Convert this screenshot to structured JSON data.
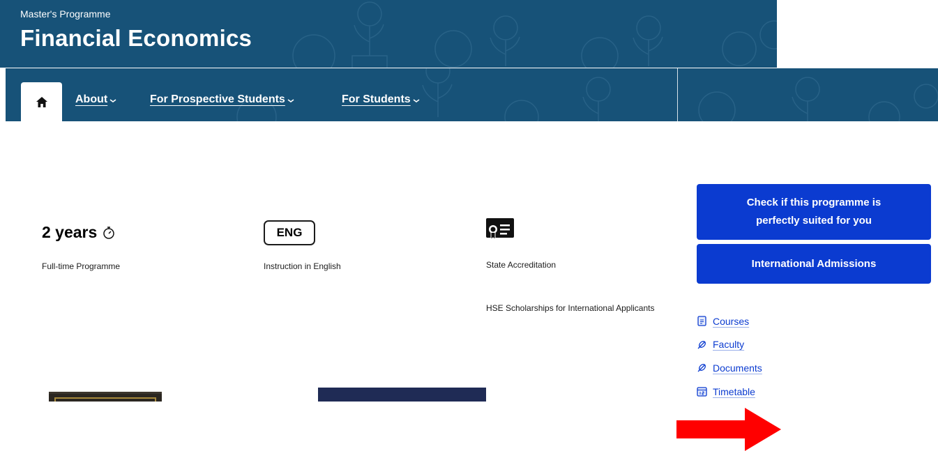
{
  "header": {
    "kicker": "Master's Programme",
    "title": "Financial Economics",
    "background_color": "#175278"
  },
  "nav": {
    "home_icon": "home-icon",
    "items": [
      {
        "label": "About"
      },
      {
        "label": "For Prospective Students"
      },
      {
        "label": "For Students"
      }
    ]
  },
  "facts": {
    "duration_value": "2 years",
    "duration_icon": "stopwatch-icon",
    "duration_caption": "Full-time Programme",
    "language_badge": "ENG",
    "language_caption": "Instruction in English",
    "accreditation_icon": "certificate-icon",
    "accreditation_caption": "State Accreditation",
    "scholarship_text": "HSE Scholarships for International Applicants"
  },
  "sidebar": {
    "cta_primary": "Check if this programme is perfectly suited for you",
    "cta_secondary": "International Admissions",
    "button_color": "#0b3bd0",
    "links": [
      {
        "label": "Courses",
        "icon": "document-icon"
      },
      {
        "label": "Faculty",
        "icon": "leaf-icon"
      },
      {
        "label": "Documents",
        "icon": "leaf-icon"
      },
      {
        "label": "Timetable",
        "icon": "calendar-icon"
      }
    ]
  },
  "annotation": {
    "arrow_color": "#ff0000"
  }
}
